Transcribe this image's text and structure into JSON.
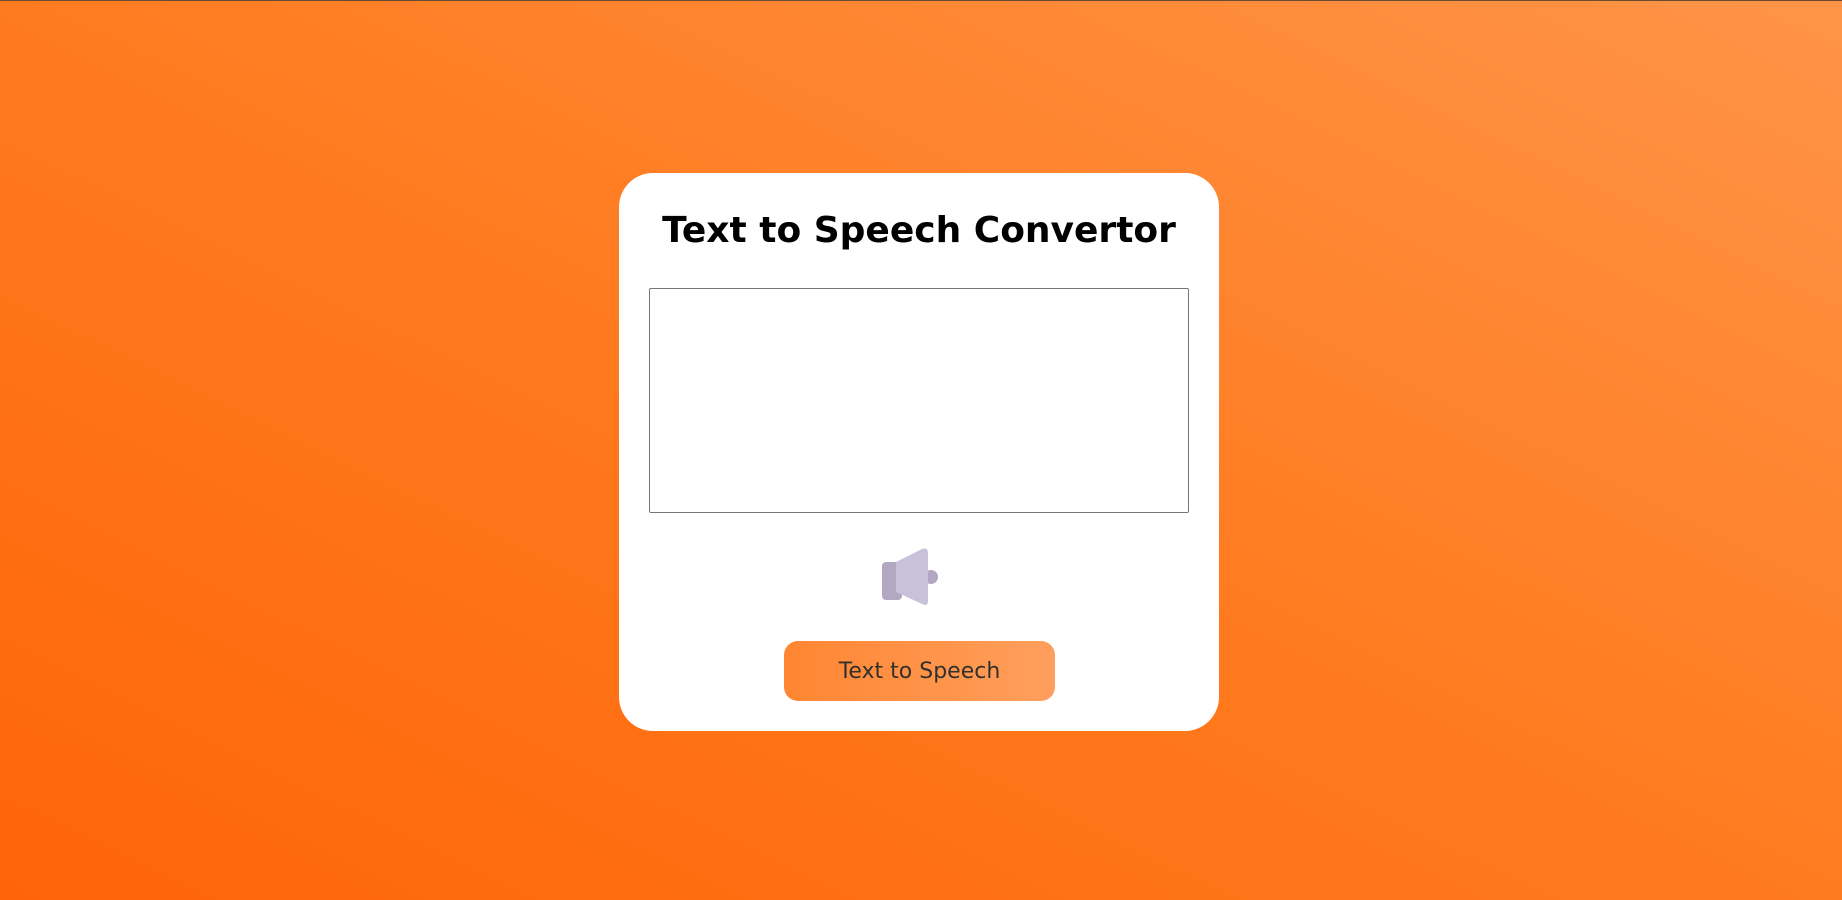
{
  "page": {
    "background_colors": [
      "#ff6408",
      "#ff9448"
    ]
  },
  "card": {
    "title": "Text to Speech Convertor",
    "text_input": {
      "value": "",
      "placeholder": ""
    },
    "speaker_icon": "speaker-icon",
    "button_label": "Text to Speech",
    "colors": {
      "button_start": "#ff8631",
      "button_end": "#ff9f5e",
      "icon_light": "#c9c1da",
      "icon_dark": "#b2a8c2"
    }
  }
}
